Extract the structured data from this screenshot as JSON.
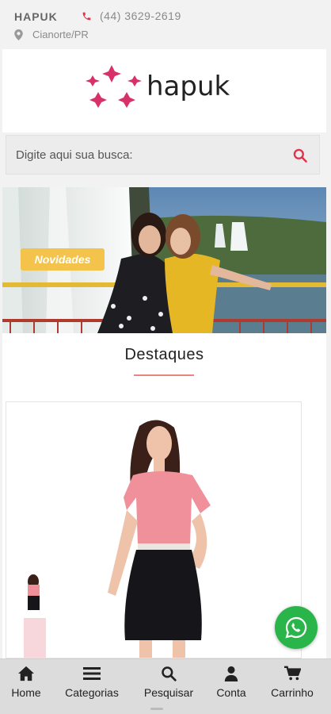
{
  "header": {
    "brand": "HAPUK",
    "phone": "(44) 3629-2619",
    "location": "Cianorte/PR",
    "logo_text": "hapuk"
  },
  "search": {
    "placeholder": "Digite aqui sua busca:"
  },
  "banner": {
    "tag": "Novidades"
  },
  "highlights": {
    "title": "Destaques"
  },
  "bottom_nav": {
    "items": [
      {
        "label": "Home",
        "icon": "home-icon"
      },
      {
        "label": "Categorias",
        "icon": "menu-icon"
      },
      {
        "label": "Pesquisar",
        "icon": "search-icon"
      },
      {
        "label": "Conta",
        "icon": "user-icon"
      },
      {
        "label": "Carrinho",
        "icon": "cart-icon"
      }
    ]
  },
  "colors": {
    "accent": "#e0334a",
    "logo_pink": "#d8306a",
    "banner_tag": "#f4c34c",
    "whatsapp": "#2ab54a",
    "underline": "#e8867d"
  }
}
